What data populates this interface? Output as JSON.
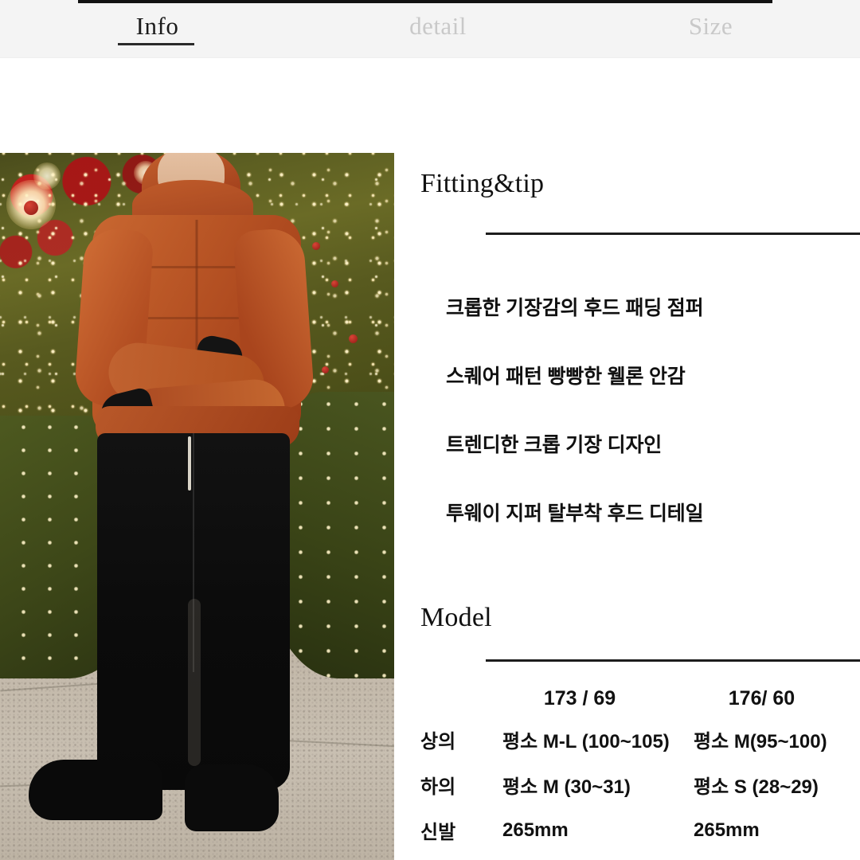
{
  "tabs": [
    {
      "label": "Info",
      "state": "active"
    },
    {
      "label": "detail",
      "state": "inactive"
    },
    {
      "label": "Size",
      "state": "inactive"
    }
  ],
  "photo": {
    "alt": "model-wearing-orange-cropped-puffer-jacket-in-front-of-christmas-tree",
    "jacket_color": "#b8561f",
    "pants_color": "#101010"
  },
  "fitting": {
    "heading": "Fitting&tip",
    "bullets": [
      "크롭한 기장감의 후드 패딩 점퍼",
      "스퀘어 패턴 빵빵한 웰론 안감",
      "트렌디한 크롭 기장 디자인",
      "투웨이 지퍼 탈부착 후드 디테일"
    ]
  },
  "model": {
    "heading": "Model",
    "columns": [
      "",
      "173 / 69",
      "176/ 60"
    ],
    "rows": [
      {
        "label": "상의",
        "a": "평소 M-L (100~105)",
        "b": "평소 M(95~100)"
      },
      {
        "label": "하의",
        "a": "평소 M (30~31)",
        "b": "평소 S (28~29)"
      },
      {
        "label": "신발",
        "a": "265mm",
        "b": "265mm"
      }
    ]
  },
  "colors": {
    "accent": "#b8561f",
    "text": "#111111",
    "inactive_tab": "#c9c9c9",
    "tabbar_bg": "#f4f4f4"
  }
}
